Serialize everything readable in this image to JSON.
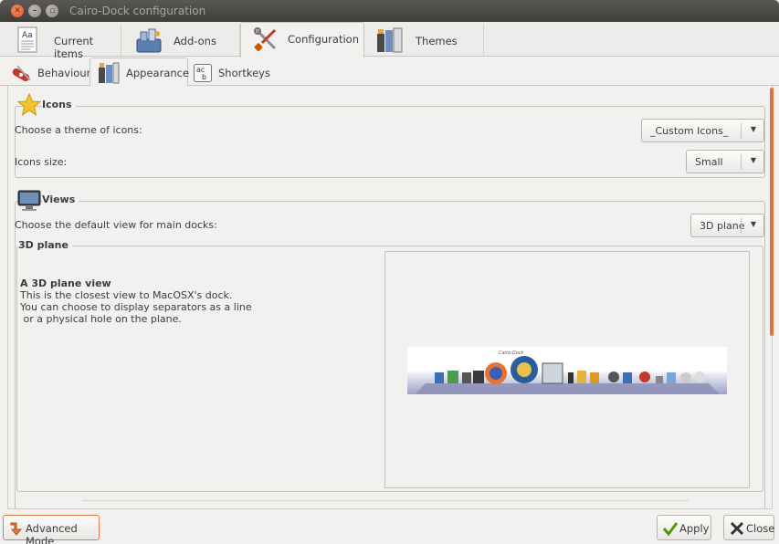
{
  "window": {
    "title": "Cairo-Dock configuration"
  },
  "tabs_top": [
    {
      "label": "Current items",
      "icon": "document-icon"
    },
    {
      "label": "Add-ons",
      "icon": "addons-icon"
    },
    {
      "label": "Configuration",
      "icon": "tools-icon",
      "active": true
    },
    {
      "label": "Themes",
      "icon": "themes-icon"
    }
  ],
  "tabs_sub": [
    {
      "label": "Behaviour",
      "icon": "swiss-knife-icon"
    },
    {
      "label": "Appearance",
      "icon": "paint-icon",
      "active": true
    },
    {
      "label": "Shortkeys",
      "icon": "keyboard-icon"
    }
  ],
  "icons_section": {
    "title": "Icons",
    "theme_label": "Choose a theme of icons:",
    "theme_value": "_Custom Icons_",
    "size_label": "Icons size:",
    "size_value": "Small"
  },
  "views_section": {
    "title": "Views",
    "view_label": "Choose the default view for main docks:",
    "view_value": "3D plane",
    "subframe_title": "3D plane",
    "desc_title": "A 3D plane view",
    "desc_lines": "This is the closest view to MacOSX's dock.\nYou can choose to display separators as a line\n or a physical hole on the plane."
  },
  "footer": {
    "advanced_label": "Advanced Mode",
    "apply_label": "Apply",
    "close_label": "Close"
  },
  "colors": {
    "accent": "#e4703e",
    "background": "#f2f1f0",
    "titlebar": "#4a4945"
  }
}
